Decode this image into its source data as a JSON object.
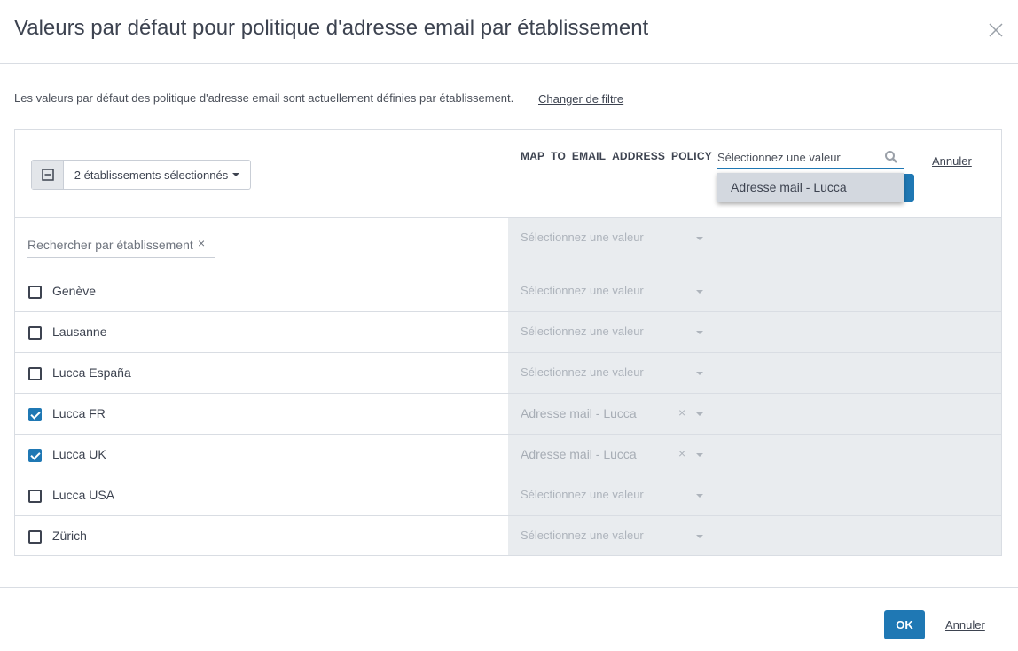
{
  "dialog": {
    "title": "Valeurs par défaut pour politique d'adresse email par établissement",
    "close_icon": "close-icon"
  },
  "intro": {
    "text": "Les valeurs par défaut des politique d'adresse email sont actuellement définies par établissement.",
    "change_filter_label": "Changer de filtre"
  },
  "toolbar": {
    "selection_label": "2 établissements sélectionnés",
    "toggle_icon": "minus-square-icon",
    "column_header": "MAP_TO_EMAIL_ADDRESS_POLICY",
    "value_search_placeholder": "Sélectionnez une valeur",
    "search_icon": "search-icon",
    "dropdown_option": "Adresse mail - Lucca",
    "cancel_label": "Annuler"
  },
  "filter_row": {
    "search_placeholder": "Rechercher par établissement",
    "clear_symbol": "×",
    "value_placeholder": "Sélectionnez une valeur"
  },
  "rows": [
    {
      "name": "Genève",
      "checked": false,
      "value": "Sélectionnez une valeur",
      "has_value": false
    },
    {
      "name": "Lausanne",
      "checked": false,
      "value": "Sélectionnez une valeur",
      "has_value": false
    },
    {
      "name": "Lucca España",
      "checked": false,
      "value": "Sélectionnez une valeur",
      "has_value": false
    },
    {
      "name": "Lucca FR",
      "checked": true,
      "value": "Adresse mail - Lucca",
      "has_value": true
    },
    {
      "name": "Lucca UK",
      "checked": true,
      "value": "Adresse mail - Lucca",
      "has_value": true
    },
    {
      "name": "Lucca USA",
      "checked": false,
      "value": "Sélectionnez une valeur",
      "has_value": false
    },
    {
      "name": "Zürich",
      "checked": false,
      "value": "Sélectionnez une valeur",
      "has_value": false
    }
  ],
  "footer": {
    "ok_label": "OK",
    "cancel_label": "Annuler"
  },
  "colors": {
    "accent": "#1f78b4",
    "disabled_panel": "#e9ecef",
    "border": "#d9dde3"
  }
}
